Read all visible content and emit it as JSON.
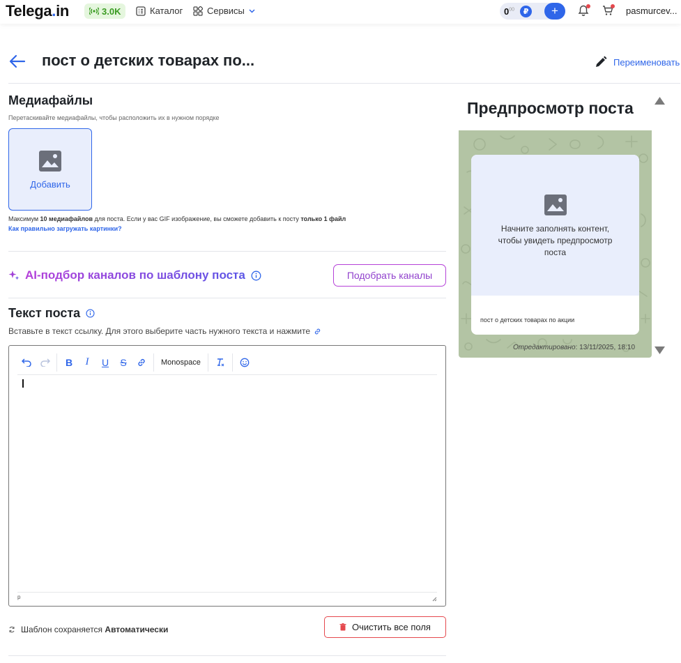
{
  "topbar": {
    "logo_main": "Telega",
    "logo_dot": ".",
    "logo_end": "in",
    "balance_badge": "3.0K",
    "catalog": "Каталог",
    "services": "Сервисы",
    "wallet_amount": "0",
    "wallet_cents": "00",
    "currency": "₽",
    "add": "+",
    "username": "pasmurcev..."
  },
  "header": {
    "title": "пост о детских товарах по...",
    "rename": "Переименовать"
  },
  "media": {
    "title": "Медиафайлы",
    "hint": "Перетаскивайте медиафайлы, чтобы расположить их в нужном порядке",
    "add_label": "Добавить",
    "note_prefix": "Максимум ",
    "note_bold1": "10 медиафайлов",
    "note_mid": " для поста. Если у вас GIF изображение, вы сможете добавить к посту ",
    "note_bold2": "только 1 файл",
    "help_link": "Как правильно загружать картинки?"
  },
  "ai": {
    "title": "AI-подбор каналов по шаблону поста",
    "button": "Подобрать каналы"
  },
  "text": {
    "title": "Текст поста",
    "description": "Вставьте в текст ссылку. Для этого выберите часть нужного текста и нажмите",
    "toolbar_monospace": "Monospace",
    "status_path": "p"
  },
  "footer": {
    "autosave_prefix": "Шаблон сохраняется ",
    "autosave_bold": "Автоматически",
    "clear_button": "Очистить все поля"
  },
  "preview": {
    "title": "Предпросмотр поста",
    "placeholder": "Начните заполнять контент, чтобы увидеть предпросмотр поста",
    "post_text": "пост о детских товарах по акции",
    "edited_label": "Отредактировано",
    "edited_value": ": 13/11/2025, 18:10"
  },
  "colors": {
    "accent": "#2f66e9",
    "danger": "#e5484d",
    "ai_start": "#b43fd9",
    "ai_end": "#5a55e6",
    "preview_bg": "#b3c4a4"
  }
}
